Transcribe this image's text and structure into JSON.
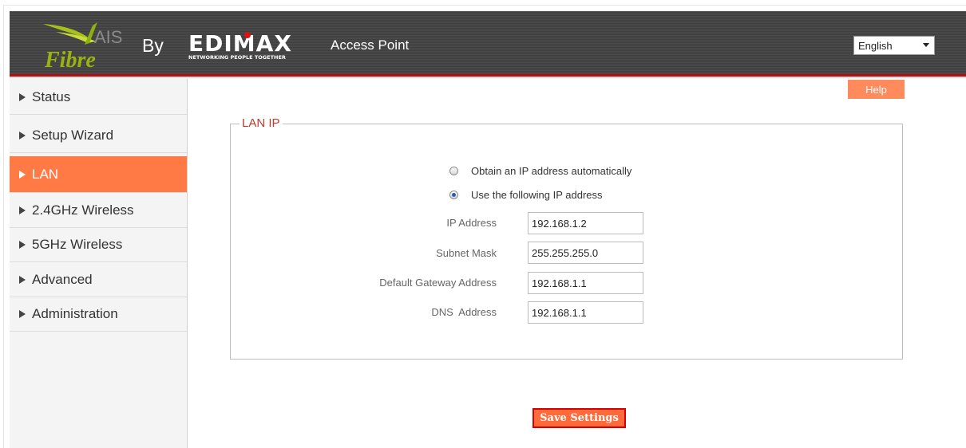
{
  "header": {
    "brand_top": "AIS",
    "brand_bottom": "Fibre",
    "by_label": "By",
    "edimax_name": "EDIMAX",
    "edimax_tagline": "NETWORKING PEOPLE TOGETHER",
    "product": "Access Point",
    "language": {
      "selected": "English",
      "options": [
        "English"
      ]
    },
    "colors": {
      "accent_red": "#b01010",
      "logo_green": "#a6c21a"
    }
  },
  "sidebar": {
    "items": [
      {
        "label": "Status",
        "active": false
      },
      {
        "label": "Setup Wizard",
        "active": false
      },
      {
        "label": "LAN",
        "active": true
      },
      {
        "label": "2.4GHz Wireless",
        "active": false
      },
      {
        "label": "5GHz Wireless",
        "active": false
      },
      {
        "label": "Advanced",
        "active": false
      },
      {
        "label": "Administration",
        "active": false
      }
    ],
    "active_color": "#ff7a45"
  },
  "help_label": "Help",
  "lan_ip": {
    "legend": "LAN IP",
    "options": [
      {
        "label": "Obtain an IP address automatically",
        "checked": false
      },
      {
        "label": "Use the following IP address",
        "checked": true
      }
    ],
    "fields": [
      {
        "label": "IP Address",
        "value": "192.168.1.2"
      },
      {
        "label": "Subnet Mask",
        "value": "255.255.255.0"
      },
      {
        "label": "Default Gateway Address",
        "value": "192.168.1.1"
      },
      {
        "label": "DNS  Address",
        "value": "192.168.1.1"
      }
    ]
  },
  "save_label": "Save Settings"
}
